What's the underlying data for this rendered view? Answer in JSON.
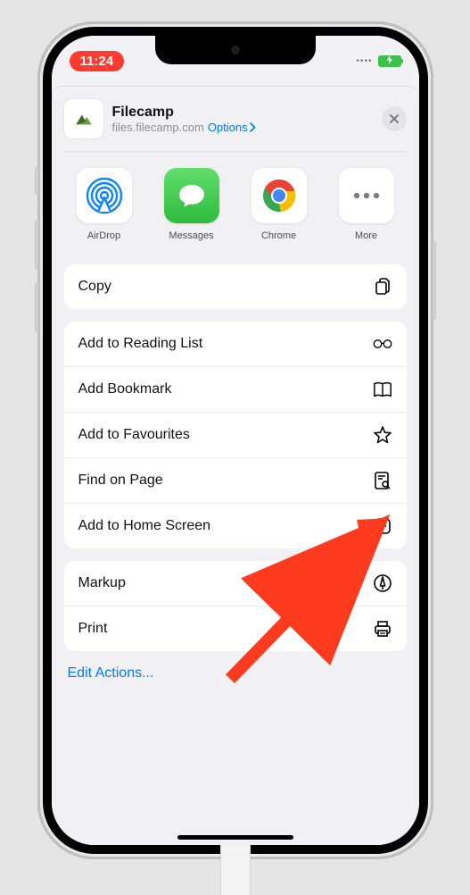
{
  "status": {
    "time": "11:24"
  },
  "sheet": {
    "title": "Filecamp",
    "subtitle": "files.filecamp.com",
    "options_label": "Options"
  },
  "apps": {
    "airdrop": "AirDrop",
    "messages": "Messages",
    "chrome": "Chrome",
    "more": "More"
  },
  "group1": {
    "copy": "Copy"
  },
  "group2": {
    "reading": "Add to Reading List",
    "bookmark": "Add Bookmark",
    "favourites": "Add to Favourites",
    "find": "Find on Page",
    "homescreen": "Add to Home Screen"
  },
  "group3": {
    "markup": "Markup",
    "print": "Print"
  },
  "footer": {
    "edit": "Edit Actions..."
  }
}
